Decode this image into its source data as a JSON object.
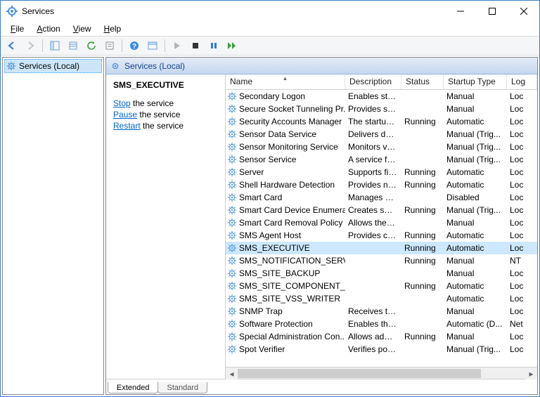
{
  "window": {
    "title": "Services"
  },
  "menu": {
    "file": "File",
    "action": "Action",
    "view": "View",
    "help": "Help"
  },
  "tree": {
    "root": "Services (Local)"
  },
  "panel": {
    "header": "Services (Local)"
  },
  "detail": {
    "selected_name": "SMS_EXECUTIVE",
    "stop_link": "Stop",
    "stop_suffix": " the service",
    "pause_link": "Pause",
    "pause_suffix": " the service",
    "restart_link": "Restart",
    "restart_suffix": " the service"
  },
  "columns": {
    "name": "Name",
    "description": "Description",
    "status": "Status",
    "startup": "Startup Type",
    "logon": "Log"
  },
  "tabs": {
    "extended": "Extended",
    "standard": "Standard"
  },
  "services": [
    {
      "name": "Secondary Logon",
      "desc": "Enables star...",
      "status": "",
      "startup": "Manual",
      "log": "Loc"
    },
    {
      "name": "Secure Socket Tunneling Pr...",
      "desc": "Provides su...",
      "status": "",
      "startup": "Manual",
      "log": "Loc"
    },
    {
      "name": "Security Accounts Manager",
      "desc": "The startup ...",
      "status": "Running",
      "startup": "Automatic",
      "log": "Loc"
    },
    {
      "name": "Sensor Data Service",
      "desc": "Delivers dat...",
      "status": "",
      "startup": "Manual (Trig...",
      "log": "Loc"
    },
    {
      "name": "Sensor Monitoring Service",
      "desc": "Monitors va...",
      "status": "",
      "startup": "Manual (Trig...",
      "log": "Loc"
    },
    {
      "name": "Sensor Service",
      "desc": "A service fo...",
      "status": "",
      "startup": "Manual (Trig...",
      "log": "Loc"
    },
    {
      "name": "Server",
      "desc": "Supports fil...",
      "status": "Running",
      "startup": "Automatic",
      "log": "Loc"
    },
    {
      "name": "Shell Hardware Detection",
      "desc": "Provides no...",
      "status": "Running",
      "startup": "Automatic",
      "log": "Loc"
    },
    {
      "name": "Smart Card",
      "desc": "Manages ac...",
      "status": "",
      "startup": "Disabled",
      "log": "Loc"
    },
    {
      "name": "Smart Card Device Enumera...",
      "desc": "Creates soft...",
      "status": "Running",
      "startup": "Manual (Trig...",
      "log": "Loc"
    },
    {
      "name": "Smart Card Removal Policy",
      "desc": "Allows the s...",
      "status": "",
      "startup": "Manual",
      "log": "Loc"
    },
    {
      "name": "SMS Agent Host",
      "desc": "Provides ch...",
      "status": "Running",
      "startup": "Automatic",
      "log": "Loc"
    },
    {
      "name": "SMS_EXECUTIVE",
      "desc": "",
      "status": "Running",
      "startup": "Automatic",
      "log": "Loc",
      "selected": true
    },
    {
      "name": "SMS_NOTIFICATION_SERVER",
      "desc": "",
      "status": "Running",
      "startup": "Manual",
      "log": "NT "
    },
    {
      "name": "SMS_SITE_BACKUP",
      "desc": "",
      "status": "",
      "startup": "Manual",
      "log": "Loc"
    },
    {
      "name": "SMS_SITE_COMPONENT_M...",
      "desc": "",
      "status": "Running",
      "startup": "Automatic",
      "log": "Loc"
    },
    {
      "name": "SMS_SITE_VSS_WRITER",
      "desc": "",
      "status": "",
      "startup": "Automatic",
      "log": "Loc"
    },
    {
      "name": "SNMP Trap",
      "desc": "Receives tra...",
      "status": "",
      "startup": "Manual",
      "log": "Loc"
    },
    {
      "name": "Software Protection",
      "desc": "Enables the ...",
      "status": "",
      "startup": "Automatic (D...",
      "log": "Net"
    },
    {
      "name": "Special Administration Con...",
      "desc": "Allows adm...",
      "status": "Running",
      "startup": "Manual",
      "log": "Loc"
    },
    {
      "name": "Spot Verifier",
      "desc": "Verifies pote...",
      "status": "",
      "startup": "Manual (Trig...",
      "log": "Loc"
    }
  ]
}
